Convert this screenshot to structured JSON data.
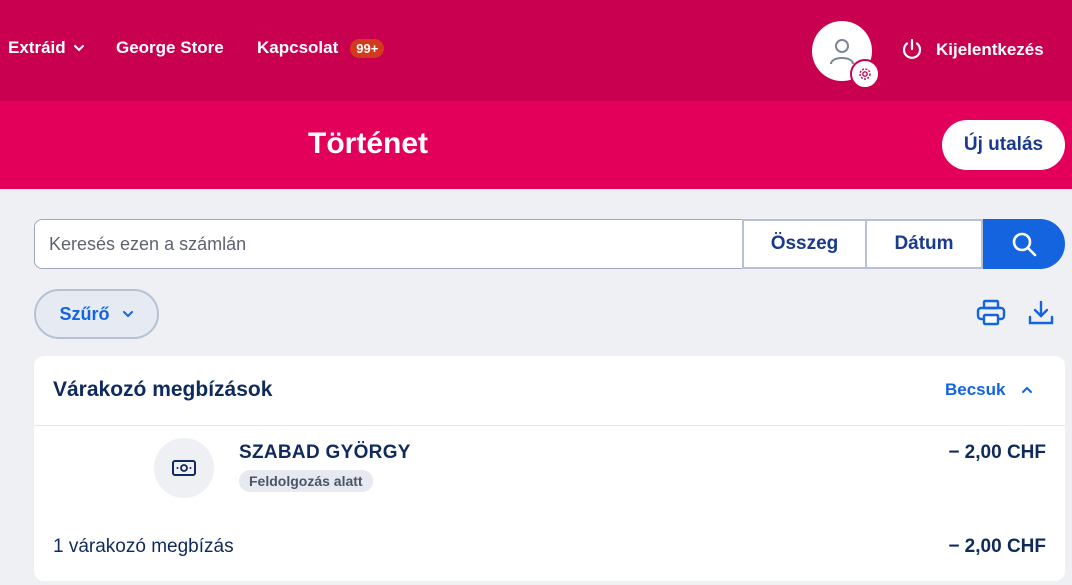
{
  "nav": {
    "extras_label": "Extráid",
    "store_label": "George Store",
    "contact_label": "Kapcsolat",
    "contact_badge": "99+",
    "logout_label": "Kijelentkezés"
  },
  "header": {
    "title": "Történet",
    "new_transfer_label": "Új utalás"
  },
  "search": {
    "placeholder": "Keresés ezen a számlán",
    "amount_label": "Összeg",
    "date_label": "Dátum"
  },
  "filter": {
    "label": "Szűrő"
  },
  "pending": {
    "title": "Várakozó megbízások",
    "collapse_label": "Becsuk",
    "items": [
      {
        "name": "SZABAD GYÖRGY",
        "status": "Feldolgozás alatt",
        "amount": "− 2,00 CHF",
        "icon": "banknote-icon"
      }
    ],
    "summary_label": "1 várakozó megbízás",
    "summary_amount": "− 2,00 CHF"
  },
  "colors": {
    "nav_bg": "#c9004f",
    "header_bg": "#e2005a",
    "accent_blue": "#1464e0",
    "navy_text": "#0f2a5c",
    "badge": "#d23a1e"
  }
}
